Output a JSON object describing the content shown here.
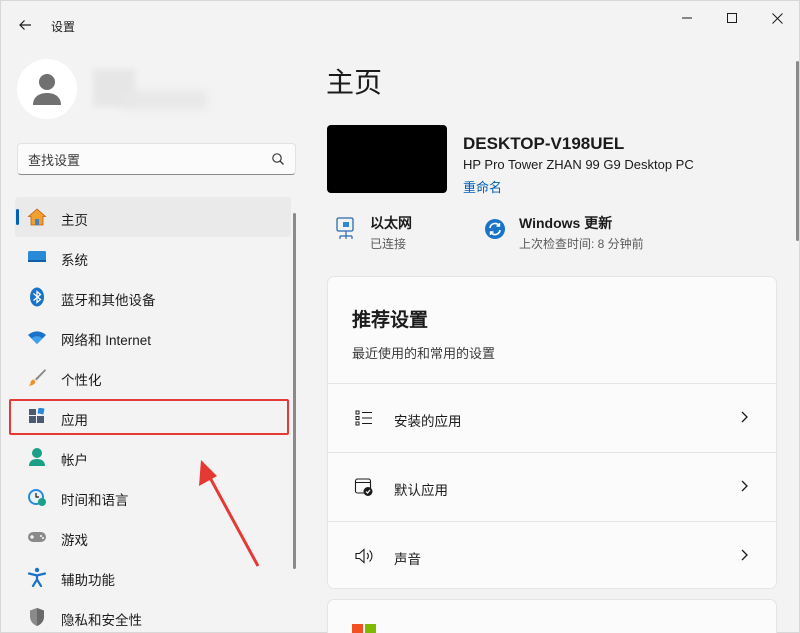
{
  "window": {
    "title": "设置"
  },
  "user": {
    "name": ""
  },
  "search": {
    "placeholder": "查找设置"
  },
  "sidebar": {
    "items": [
      {
        "label": "主页",
        "icon": "home-icon",
        "active": true
      },
      {
        "label": "系统",
        "icon": "system-icon"
      },
      {
        "label": "蓝牙和其他设备",
        "icon": "bluetooth-icon"
      },
      {
        "label": "网络和 Internet",
        "icon": "wifi-icon"
      },
      {
        "label": "个性化",
        "icon": "brush-icon"
      },
      {
        "label": "应用",
        "icon": "apps-icon"
      },
      {
        "label": "帐户",
        "icon": "account-icon"
      },
      {
        "label": "时间和语言",
        "icon": "clock-globe-icon"
      },
      {
        "label": "游戏",
        "icon": "gamepad-icon"
      },
      {
        "label": "辅助功能",
        "icon": "accessibility-icon"
      },
      {
        "label": "隐私和安全性",
        "icon": "shield-icon"
      }
    ]
  },
  "main": {
    "title": "主页",
    "device": {
      "name": "DESKTOP-V198UEL",
      "model": "HP Pro Tower ZHAN 99 G9 Desktop PC",
      "rename": "重命名"
    },
    "status": [
      {
        "title": "以太网",
        "subtitle": "已连接",
        "icon": "ethernet-icon"
      },
      {
        "title": "Windows 更新",
        "subtitle": "上次检查时间: 8 分钟前",
        "icon": "windows-update-icon"
      }
    ],
    "recommended": {
      "title": "推荐设置",
      "subtitle": "最近使用的和常用的设置",
      "items": [
        {
          "label": "安装的应用",
          "icon": "installed-apps-icon"
        },
        {
          "label": "默认应用",
          "icon": "default-apps-icon"
        },
        {
          "label": "声音",
          "icon": "speaker-icon"
        }
      ]
    }
  },
  "colors": {
    "accent": "#005fb8",
    "highlight": "#e53935"
  }
}
